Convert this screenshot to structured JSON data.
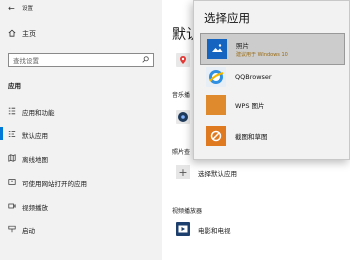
{
  "window": {
    "back_label": "←",
    "title": "设置"
  },
  "sidebar": {
    "home_label": "主页",
    "search_placeholder": "查找设置",
    "section_label": "应用",
    "items": [
      {
        "label": "应用和功能",
        "icon": "apps-list-icon"
      },
      {
        "label": "默认应用",
        "icon": "default-apps-icon",
        "active": true
      },
      {
        "label": "离线地图",
        "icon": "offline-map-icon"
      },
      {
        "label": "可使用网站打开的应用",
        "icon": "website-apps-icon"
      },
      {
        "label": "视频播放",
        "icon": "video-playback-icon"
      },
      {
        "label": "启动",
        "icon": "startup-icon"
      }
    ]
  },
  "main": {
    "heading": "默认",
    "music_label": "音乐播",
    "photo_label": "照片查",
    "choose_default_label": "选择默认应用",
    "video_label": "视频播放器",
    "video_app": "电影和电视"
  },
  "popup": {
    "title": "选择应用",
    "apps": [
      {
        "name": "照片",
        "subtitle": "建议用于 Windows 10",
        "icon": "photos-app-icon",
        "selected": true,
        "color": "#1565c0"
      },
      {
        "name": "QQBrowser",
        "subtitle": "",
        "icon": "qqbrowser-icon",
        "color": "#2f8fe0"
      },
      {
        "name": "WPS 图片",
        "subtitle": "",
        "icon": "wps-pictures-icon",
        "color": "#e08a2e"
      },
      {
        "name": "截图和草图",
        "subtitle": "",
        "icon": "snip-sketch-icon",
        "color": "#e07a20"
      }
    ]
  }
}
